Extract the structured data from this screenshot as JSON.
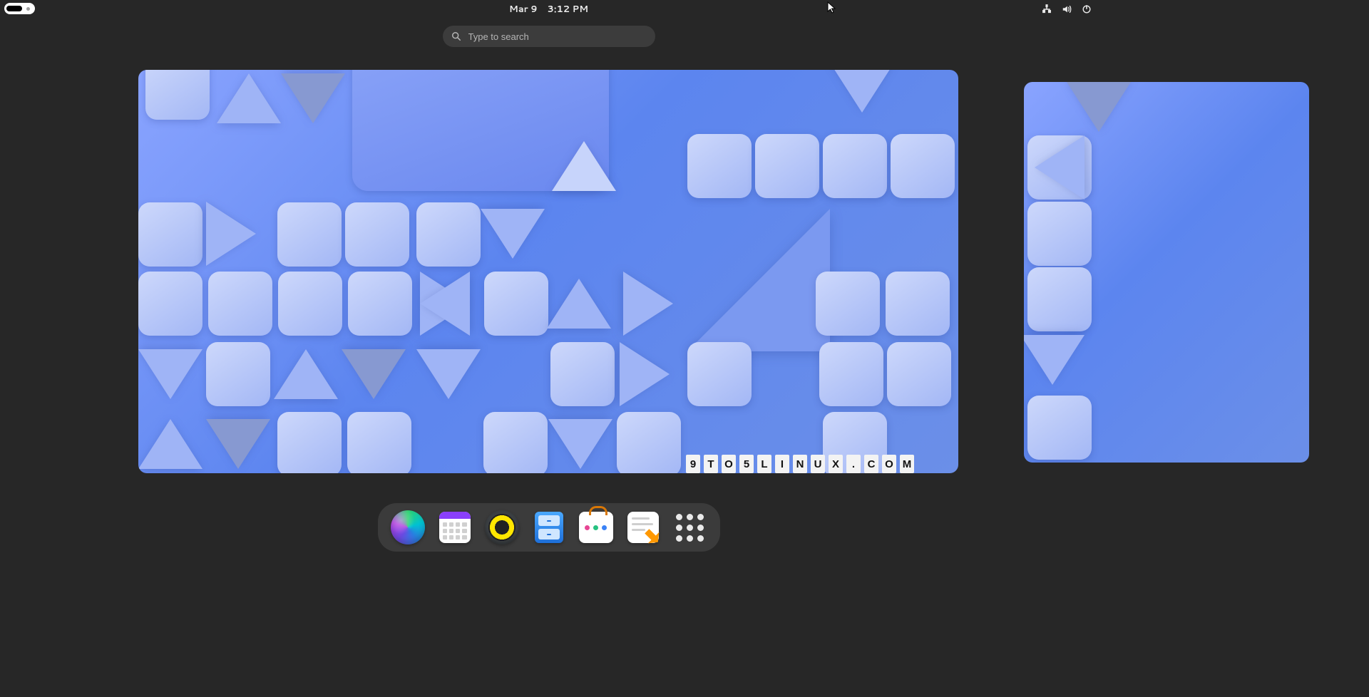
{
  "topbar": {
    "date": "Mar 9",
    "time": "3:12 PM",
    "status_icons": [
      "network-wired-icon",
      "volume-icon",
      "power-icon"
    ]
  },
  "search": {
    "placeholder": "Type to search"
  },
  "workspaces": {
    "count": 2,
    "active": 0
  },
  "watermark": {
    "text": "9TO5LINUX.COM",
    "chars": [
      "9",
      "T",
      "O",
      "5",
      "L",
      "I",
      "N",
      "U",
      "X",
      ".",
      "C",
      "O",
      "M"
    ]
  },
  "dock": {
    "items": [
      {
        "name": "web-browser",
        "label": "Web Browser"
      },
      {
        "name": "calendar",
        "label": "Calendar"
      },
      {
        "name": "music",
        "label": "Rhythmbox"
      },
      {
        "name": "files",
        "label": "Files"
      },
      {
        "name": "software",
        "label": "Software"
      },
      {
        "name": "text-editor",
        "label": "Text Editor"
      },
      {
        "name": "app-grid",
        "label": "Show Applications"
      }
    ]
  }
}
